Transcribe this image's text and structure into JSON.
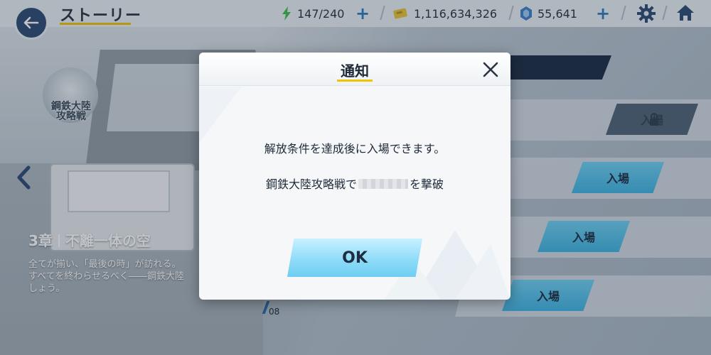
{
  "topbar": {
    "title": "ストーリー",
    "stamina": "147/240",
    "coins": "1,116,634,326",
    "gems": "55,641"
  },
  "left_panel": {
    "badge_text": "鋼鉄大陸\n攻略戦",
    "chapter_num": "3章",
    "chapter_title": "不離一体の空",
    "description": "全てが揃い、「最後の時」が訪れる。\nすべてを終わらせるべく――鋼鉄大陸\nしょう。"
  },
  "stages": [
    {
      "label": "入場",
      "locked": true
    },
    {
      "label": "入場",
      "locked": false
    },
    {
      "label": "入場",
      "locked": false
    },
    {
      "label": "入場",
      "locked": false
    }
  ],
  "stage_number": "08",
  "dialog": {
    "title": "通知",
    "message": "解放条件を達成後に入場できます。",
    "condition_prefix": "鋼鉄大陸攻略戦で",
    "condition_suffix": "を撃破",
    "ok_label": "OK"
  },
  "icons": {
    "back": "back-arrow-icon",
    "stamina": "lightning-icon",
    "coin": "coin-card-icon",
    "gem": "gem-icon",
    "settings": "gear-icon",
    "home": "home-icon",
    "close": "close-icon",
    "lock": "lock-icon",
    "left": "chevron-left-icon"
  },
  "colors": {
    "accent_yellow": "#f0c400",
    "enter_blue": "#3fb4e2",
    "dark_navy": "#1d2c45",
    "plus_blue": "#2f7bc0"
  }
}
